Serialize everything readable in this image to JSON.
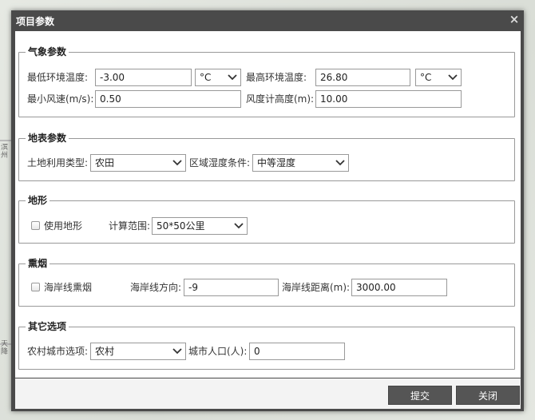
{
  "dialog": {
    "title": "项目参数",
    "close_glyph": "×"
  },
  "map_bg": {
    "label1": "滨州",
    "label2": "天降"
  },
  "meteo": {
    "title": "气象参数",
    "min_temp": {
      "label": "最低环境温度:",
      "value": "-3.00",
      "unit": "°C"
    },
    "max_temp": {
      "label": "最高环境温度:",
      "value": "26.80",
      "unit": "°C"
    },
    "min_wind": {
      "label": "最小风速(m/s):",
      "value": "0.50"
    },
    "anemo_height": {
      "label": "风度计高度(m):",
      "value": "10.00"
    }
  },
  "surface": {
    "title": "地表参数",
    "landuse": {
      "label": "土地利用类型:",
      "value": "农田"
    },
    "humidity": {
      "label": "区域湿度条件:",
      "value": "中等湿度"
    }
  },
  "terrain": {
    "title": "地形",
    "use_terrain": {
      "label": "使用地形",
      "checked": false
    },
    "range": {
      "label": "计算范围:",
      "value": "50*50公里"
    }
  },
  "fumigation": {
    "title": "熏烟",
    "coast": {
      "label": "海岸线熏烟",
      "checked": false
    },
    "direction": {
      "label": "海岸线方向:",
      "value": "-9"
    },
    "distance": {
      "label": "海岸线距离(m):",
      "value": "3000.00"
    }
  },
  "other": {
    "title": "其它选项",
    "rural_urban": {
      "label": "农村城市选项:",
      "value": "农村"
    },
    "population": {
      "label": "城市人口(人):",
      "value": "0"
    }
  },
  "footer": {
    "submit_label": "提交",
    "close_label": "关闭"
  }
}
